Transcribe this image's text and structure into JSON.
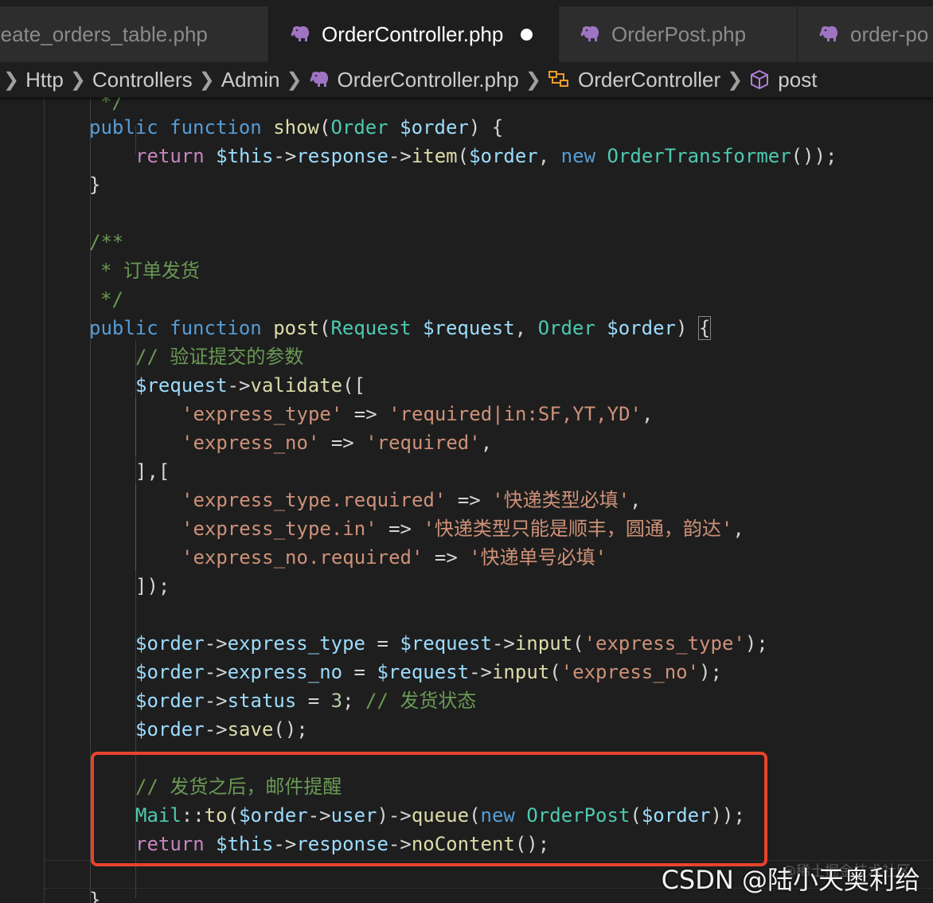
{
  "tabs": [
    {
      "label": "reate_orders_table.php",
      "active": false
    },
    {
      "label": "OrderController.php",
      "active": true,
      "modified": true
    },
    {
      "label": "OrderPost.php",
      "active": false
    },
    {
      "label": "order-po",
      "active": false
    }
  ],
  "breadcrumb": {
    "items": [
      "Http",
      "Controllers",
      "Admin",
      "OrderController.php",
      "OrderController",
      "post"
    ]
  },
  "code": {
    "l0": "*/",
    "l1": {
      "a": "public",
      "b": "function",
      "c": "show",
      "d": "(",
      "e": "Order",
      "f": "$order",
      "g": ") {"
    },
    "l2": {
      "a": "return",
      "b": "$this",
      "c": "->",
      "d": "response",
      "e": "->",
      "f": "item",
      "g": "(",
      "h": "$order",
      "i": ", ",
      "j": "new",
      "k": "OrderTransformer",
      "l": "());"
    },
    "l3": "}",
    "l5": "/**",
    "l6": "* 订单发货",
    "l7": "*/",
    "l8": {
      "a": "public",
      "b": "function",
      "c": "post",
      "d": "(",
      "e": "Request",
      "f": "$request",
      "g": ", ",
      "h": "Order",
      "i": "$order",
      "j": ") ",
      "k": "{"
    },
    "l9": "// 验证提交的参数",
    "l10": {
      "a": "$request",
      "b": "->",
      "c": "validate",
      "d": "(["
    },
    "l11": {
      "a": "'express_type'",
      "b": " => ",
      "c": "'required|in:SF,YT,YD'",
      "d": ","
    },
    "l12": {
      "a": "'express_no'",
      "b": " => ",
      "c": "'required'",
      "d": ","
    },
    "l13": "],[",
    "l14": {
      "a": "'express_type.required'",
      "b": " => ",
      "c": "'快递类型必填'",
      "d": ","
    },
    "l15": {
      "a": "'express_type.in'",
      "b": " => ",
      "c": "'快递类型只能是顺丰，圆通，韵达'",
      "d": ","
    },
    "l16": {
      "a": "'express_no.required'",
      "b": " => ",
      "c": "'快递单号必填'"
    },
    "l17": "]);",
    "l19": {
      "a": "$order",
      "b": "->",
      "c": "express_type",
      "d": " = ",
      "e": "$request",
      "f": "->",
      "g": "input",
      "h": "(",
      "i": "'express_type'",
      "j": ");"
    },
    "l20": {
      "a": "$order",
      "b": "->",
      "c": "express_no",
      "d": " = ",
      "e": "$request",
      "f": "->",
      "g": "input",
      "h": "(",
      "i": "'express_no'",
      "j": ");"
    },
    "l21": {
      "a": "$order",
      "b": "->",
      "c": "status",
      "d": " = ",
      "e": "3",
      "f": "; ",
      "g": "// 发货状态"
    },
    "l22": {
      "a": "$order",
      "b": "->",
      "c": "save",
      "d": "();"
    },
    "l24": "// 发货之后，邮件提醒",
    "l25": {
      "a": "Mail",
      "b": "::",
      "c": "to",
      "d": "(",
      "e": "$order",
      "f": "->",
      "g": "user",
      "h": ")->",
      "i": "queue",
      "j": "(",
      "k": "new",
      "l": "OrderPost",
      "m": "(",
      "n": "$order",
      "o": "));"
    },
    "l26": {
      "a": "return",
      "b": "$this",
      "c": "->",
      "d": "response",
      "e": "->",
      "f": "noContent",
      "g": "();"
    },
    "l28": "}"
  },
  "watermark": {
    "text": "CSDN @陆小天奥利给",
    "faint": "@稀土掘金技术社区"
  },
  "colors": {
    "highlight_border": "#e8432e",
    "keyword": "#569cd6",
    "control": "#c586c0",
    "string": "#ce9178",
    "comment": "#6a9955",
    "type": "#4ec9b0",
    "variable": "#9cdcfe",
    "function": "#dcdcaa"
  }
}
